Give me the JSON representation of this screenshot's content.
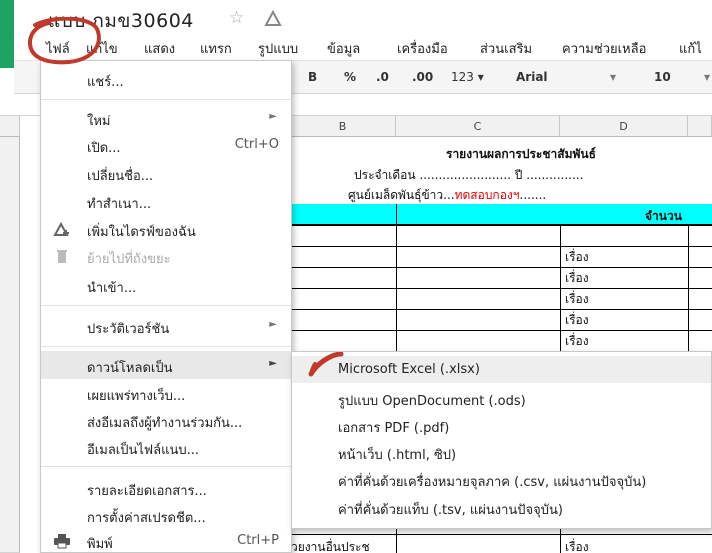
{
  "colors": {
    "sheets_green": "#1ea362",
    "cyan_fill": "#00ffff",
    "annotation_red": "#c0392b",
    "highlight": "#e8e8e8"
  },
  "titlebar": {
    "doc_title": "แบบ กมข30604"
  },
  "menubar": {
    "items": [
      "ไฟล์",
      "แก้ไข",
      "แสดง",
      "แทรก",
      "รูปแบบ",
      "ข้อมูล",
      "เครื่องมือ",
      "ส่วนเสริม",
      "ความช่วยเหลือ",
      "แก้ไ"
    ]
  },
  "toolbar": {
    "bold": "B",
    "percent": "%",
    "dec_decrease": ".0",
    "dec_increase": ".00",
    "more_formats": "123 ▾",
    "font": "Arial",
    "font_arrow": "▾",
    "size": "10",
    "size_arrow": "▾"
  },
  "grid": {
    "col_b": "B",
    "col_c": "C",
    "col_d": "D",
    "report_title": "รายงานผลการประชาสัมพันธ์",
    "month_line": "ประจำเดือน ........................ ปี ...............",
    "center_prefix": "ศูนย์เมล็ดพันธุ์ข้าว...",
    "center_red": "ทดสอบกองฯ",
    "center_suffix": ".......",
    "header_count": "จำนวน",
    "unit": "เรื่อง",
    "bottom_fragment": "่วยงานอื่นประช"
  },
  "file_menu": {
    "share": "แชร์...",
    "new": "ใหม่",
    "open": "เปิด...",
    "open_shortcut": "Ctrl+O",
    "rename": "เปลี่ยนชื่อ...",
    "make_copy": "ทำสำเนา...",
    "add_to_drive": "เพิ่มในไดรฟ์ของฉัน",
    "move_to_trash": "ย้ายไปที่ถังขยะ",
    "import": "นำเข้า...",
    "version_history": "ประวัติเวอร์ชัน",
    "download_as": "ดาวน์โหลดเป็น",
    "publish": "เผยแพร่ทางเว็บ...",
    "email_collab": "ส่งอีเมลถึงผู้ทำงานร่วมกัน...",
    "email_attach": "อีเมลเป็นไฟล์แนบ...",
    "doc_details": "รายละเอียดเอกสาร...",
    "settings": "การตั้งค่าสเปรดชีต...",
    "print": "พิมพ์",
    "print_shortcut": "Ctrl+P"
  },
  "download_submenu": {
    "xlsx": "Microsoft Excel (.xlsx)",
    "ods": "รูปแบบ OpenDocument (.ods)",
    "pdf": "เอกสาร PDF (.pdf)",
    "html": "หน้าเว็บ (.html, ซิป)",
    "csv": "ค่าที่คั่นด้วยเครื่องหมายจุลภาค (.csv, แผ่นงานปัจจุบัน)",
    "tsv": "ค่าที่คั่นด้วยแท็บ (.tsv, แผ่นงานปัจจุบัน)"
  }
}
